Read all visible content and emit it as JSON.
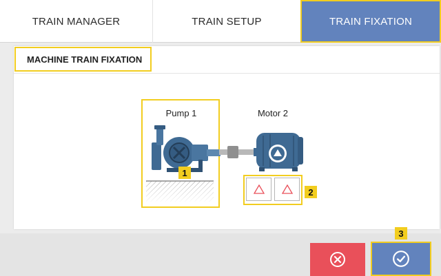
{
  "tabs": [
    {
      "label": "TRAIN MANAGER",
      "active": false
    },
    {
      "label": "TRAIN SETUP",
      "active": false
    },
    {
      "label": "TRAIN FIXATION",
      "active": true
    }
  ],
  "panel": {
    "title": "MACHINE TRAIN FIXATION"
  },
  "machines": [
    {
      "name": "Pump 1"
    },
    {
      "name": "Motor 2"
    }
  ],
  "badges": {
    "pump": "1",
    "feet": "2",
    "confirm": "3"
  },
  "colors": {
    "accent_blue": "#6283bd",
    "highlight_yellow": "#f2cd1f",
    "cancel_red": "#e9505a",
    "machine_blue": "#3f6a93"
  },
  "icons": {
    "cancel": "x-circle-icon",
    "confirm": "check-circle-icon",
    "foot": "triangle-icon"
  }
}
